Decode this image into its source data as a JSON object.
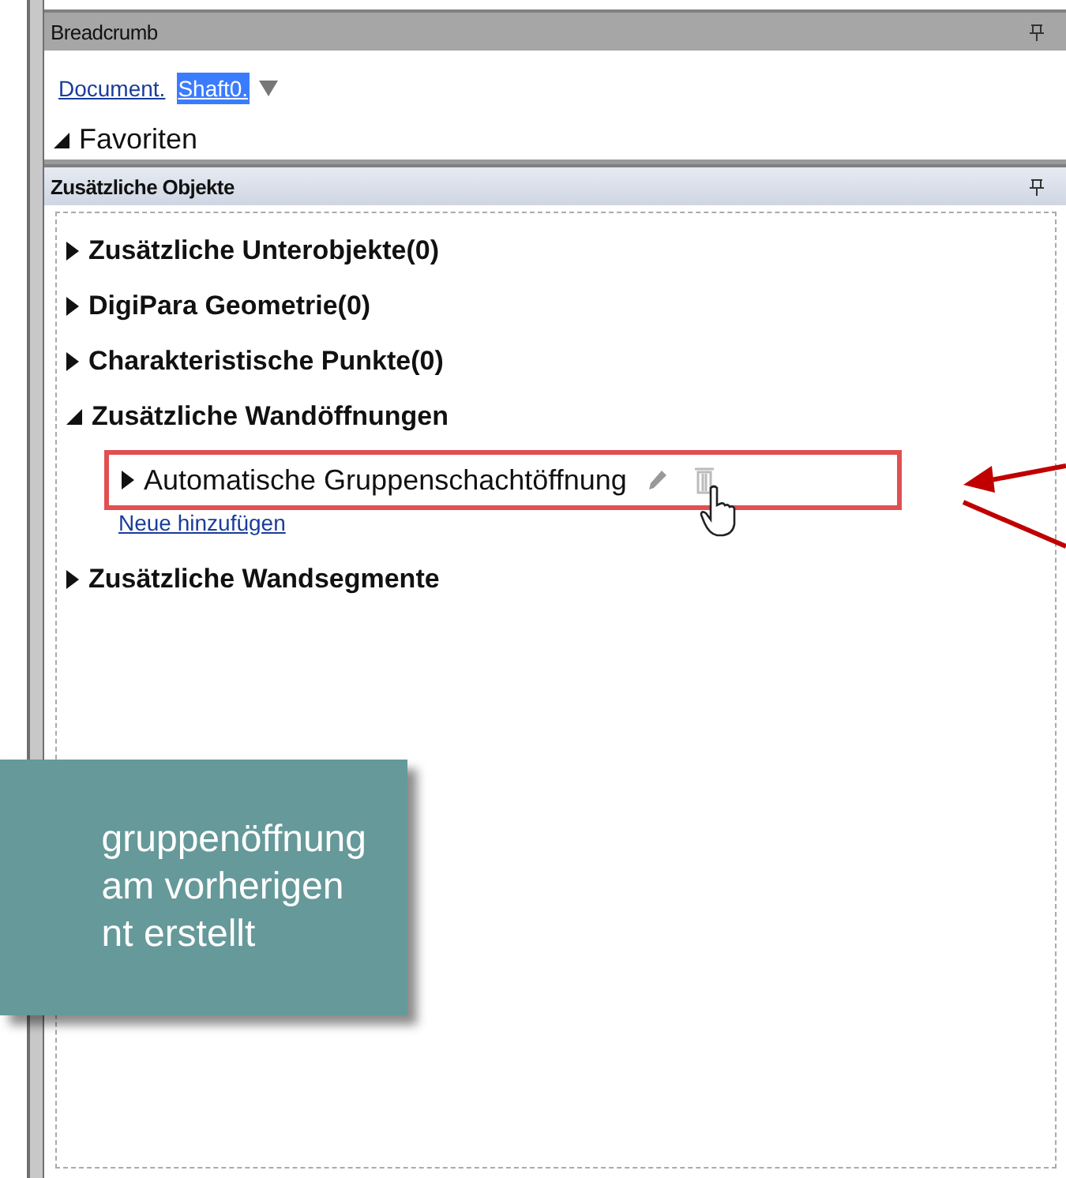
{
  "breadcrumb_panel": {
    "title": "Breadcrumb",
    "path": [
      {
        "label": "Document.",
        "selected": false
      },
      {
        "label": "Shaft0.",
        "selected": true
      }
    ],
    "favorites": {
      "label": "Favoriten",
      "expanded": true
    }
  },
  "objects_panel": {
    "title": "Zusätzliche Objekte",
    "tree": [
      {
        "label": "Zusätzliche Unterobjekte(0)",
        "expanded": false
      },
      {
        "label": "DigiPara Geometrie(0)",
        "expanded": false
      },
      {
        "label": "Charakteristische Punkte(0)",
        "expanded": false
      },
      {
        "label": "Zusätzliche Wandöffnungen",
        "expanded": true,
        "children": [
          {
            "label": "Automatische Gruppenschachtöffnung",
            "expanded": false,
            "highlighted": true
          }
        ],
        "add_link": "Neue hinzufügen"
      },
      {
        "label": "Zusätzliche Wandsegmente",
        "expanded": false
      }
    ]
  },
  "callout": {
    "lines": [
      "gruppenöffnung",
      "am vorherigen",
      "nt erstellt"
    ]
  }
}
